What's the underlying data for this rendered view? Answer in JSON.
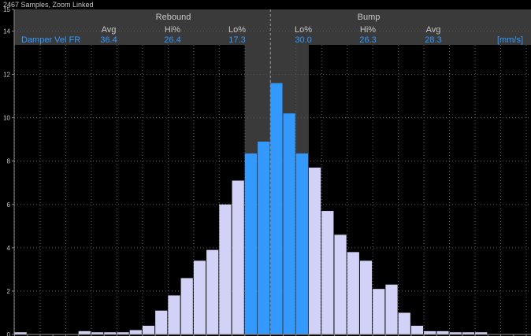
{
  "header": {
    "samples_label": "2467 Samples, Zoom Linked"
  },
  "stats": {
    "rebound_label": "Rebound",
    "bump_label": "Bump",
    "columns": [
      "Avg",
      "Hi%",
      "Lo%",
      "Lo%",
      "Hi%",
      "Avg"
    ],
    "channel": "Damper Vel FR",
    "values": [
      "36.4",
      "26.4",
      "17.3",
      "30.0",
      "26.3",
      "28.3"
    ],
    "unit": "[mm/s]"
  },
  "colors": {
    "background": "#000000",
    "bar_outer": "#d2d2f6",
    "bar_inner": "#3399ff",
    "band": "#3a3a3a",
    "grid": "#5a5a5a",
    "accent_text": "#3399ff",
    "header_text": "#c8c8c8"
  },
  "chart_data": {
    "type": "bar",
    "y_ticks": [
      "0",
      "2",
      "4",
      "6",
      "8",
      "10",
      "12",
      "14",
      "15"
    ],
    "ylim": [
      0,
      15
    ],
    "x_bins": 40,
    "center_bin": 20,
    "values": [
      0.1,
      0,
      0,
      0,
      0,
      0.15,
      0.1,
      0.1,
      0.1,
      0.2,
      0.4,
      1.1,
      1.8,
      2.6,
      3.4,
      3.9,
      6.0,
      7.1,
      8.35,
      8.9,
      11.6,
      10.2,
      8.35,
      7.7,
      5.7,
      4.6,
      3.8,
      3.4,
      2.1,
      2.3,
      1.0,
      0.4,
      0.15,
      0.15,
      0.1,
      0.1,
      0.1,
      0,
      0,
      0
    ],
    "highlight_bins": [
      18,
      19,
      20,
      21,
      22
    ],
    "grid": true,
    "series": [
      {
        "name": "Damper Vel FR",
        "values_ref": "values"
      }
    ]
  }
}
